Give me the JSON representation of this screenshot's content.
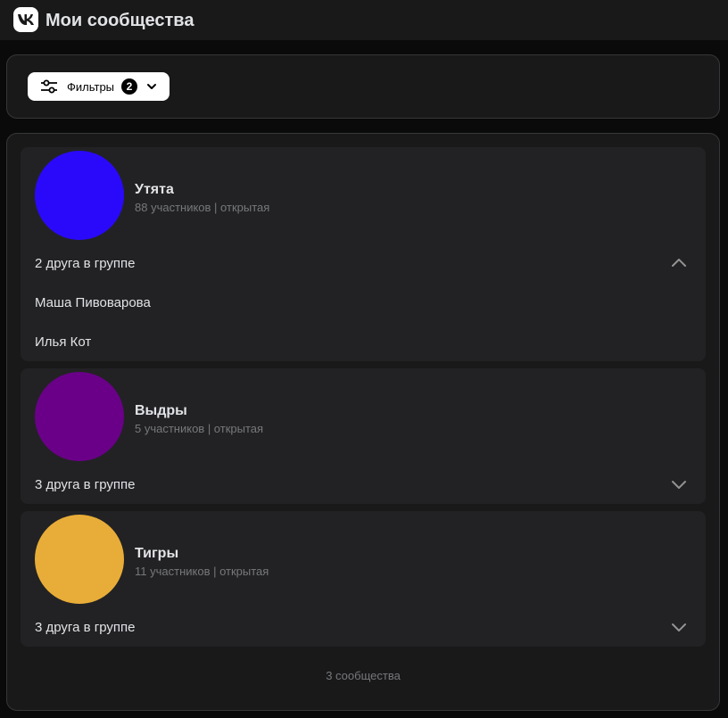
{
  "header": {
    "title": "Мои сообщества"
  },
  "filters": {
    "label": "Фильтры",
    "count": "2"
  },
  "groups": [
    {
      "name": "Утята",
      "meta": "88 участников | открытая",
      "avatar_color": "#2a09fb",
      "friends_label": "2 друга в группе",
      "expanded": true,
      "friends": [
        "Маша Пивоварова",
        "Илья Кот"
      ]
    },
    {
      "name": "Выдры",
      "meta": "5 участников | открытая",
      "avatar_color": "#6a0088",
      "friends_label": "3 друга в группе",
      "expanded": false
    },
    {
      "name": "Тигры",
      "meta": "11 участников | открытая",
      "avatar_color": "#e8ad38",
      "friends_label": "3 друга в группе",
      "expanded": false
    }
  ],
  "footer": {
    "count_text": "3 сообщества"
  }
}
